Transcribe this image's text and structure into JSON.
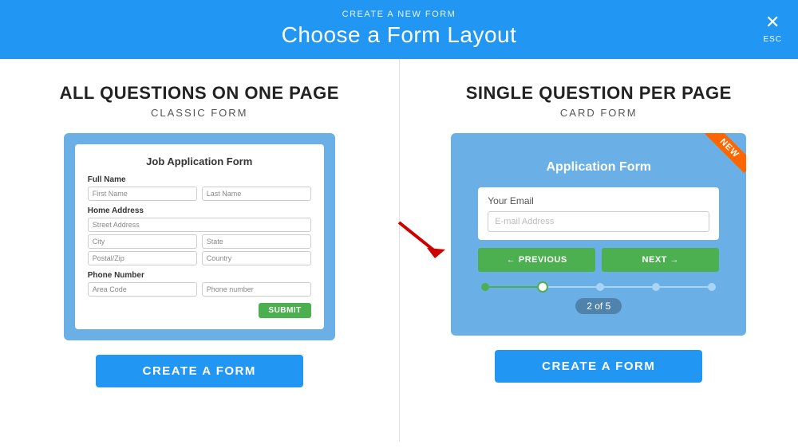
{
  "header": {
    "subtitle": "CREATE A NEW FORM",
    "title": "Choose a Form Layout",
    "close_label": "✕",
    "close_esc": "ESC"
  },
  "left_panel": {
    "title": "ALL QUESTIONS ON ONE PAGE",
    "subtitle": "CLASSIC FORM",
    "mock_form": {
      "title": "Job Application Form",
      "fields": [
        {
          "label": "Full Name",
          "inputs": [
            "First Name",
            "Last Name"
          ]
        },
        {
          "label": "Home Address",
          "inputs": [
            "Street Address"
          ]
        },
        {
          "label": "",
          "inputs": [
            "City",
            "State"
          ]
        },
        {
          "label": "",
          "inputs": [
            "Postal/Zip",
            "Country"
          ]
        },
        {
          "label": "Phone Number",
          "inputs": [
            "Area Code",
            "Phone number"
          ]
        }
      ],
      "submit_label": "SUBMIT"
    },
    "cta_label": "CREATE A FORM"
  },
  "right_panel": {
    "title": "SINGLE QUESTION PER PAGE",
    "subtitle": "CARD FORM",
    "new_badge": "NEW",
    "card_form": {
      "title": "Application Form",
      "field_label": "Your Email",
      "field_placeholder": "E-mail Address",
      "prev_label": "← PREVIOUS",
      "next_label": "NEXT →",
      "page_indicator": "2 of 5"
    },
    "cta_label": "CREATE A FORM"
  }
}
